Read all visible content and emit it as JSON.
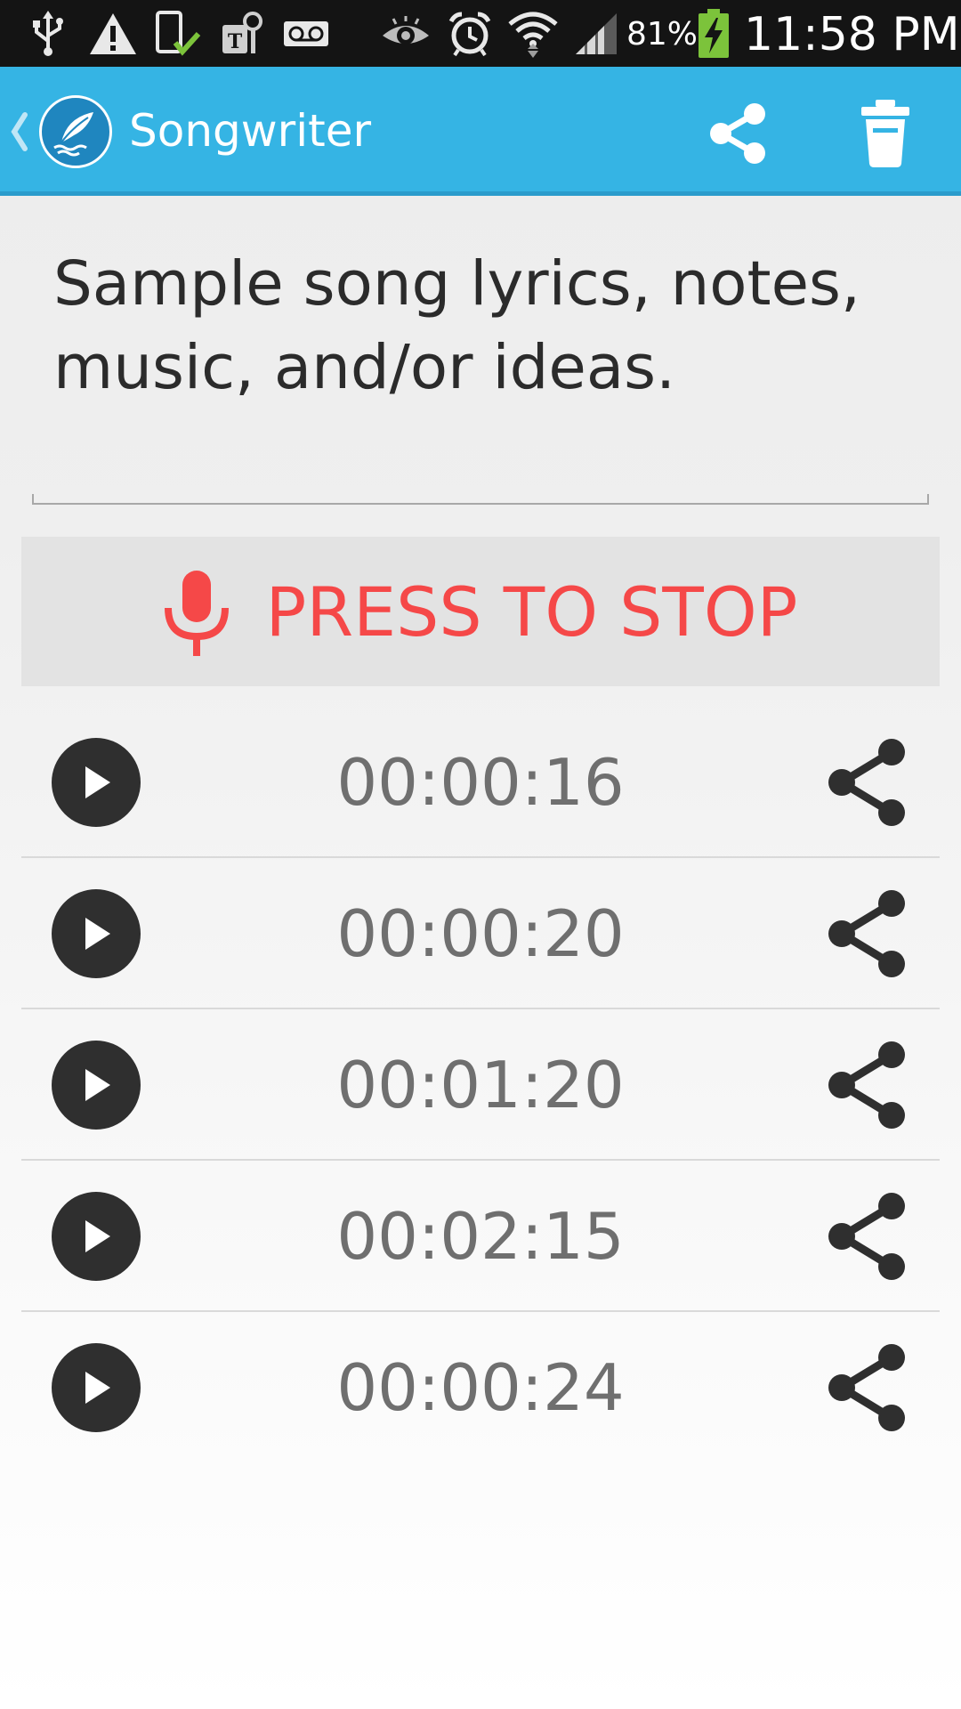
{
  "status_bar": {
    "battery_percent": "81%",
    "time": "11:58 PM",
    "icons": [
      "usb-icon",
      "warning-icon",
      "device-check-icon",
      "tmobile-icon",
      "voicemail-icon",
      "eye-icon",
      "alarm-icon",
      "wifi-icon",
      "signal-icon",
      "battery-charging-icon"
    ]
  },
  "action_bar": {
    "title": "Songwriter",
    "background_color": "#35b4e4",
    "icons": [
      "back-chevron-icon",
      "app-logo-feather-icon",
      "share-icon",
      "trash-icon"
    ]
  },
  "lyrics": {
    "text": "Sample song lyrics, notes, music, and/or ideas."
  },
  "record_button": {
    "label": "PRESS TO STOP",
    "color": "#f54848",
    "icon": "microphone-icon"
  },
  "recordings": [
    {
      "duration": "00:00:16"
    },
    {
      "duration": "00:00:20"
    },
    {
      "duration": "00:01:20"
    },
    {
      "duration": "00:02:15"
    },
    {
      "duration": "00:00:24"
    }
  ]
}
